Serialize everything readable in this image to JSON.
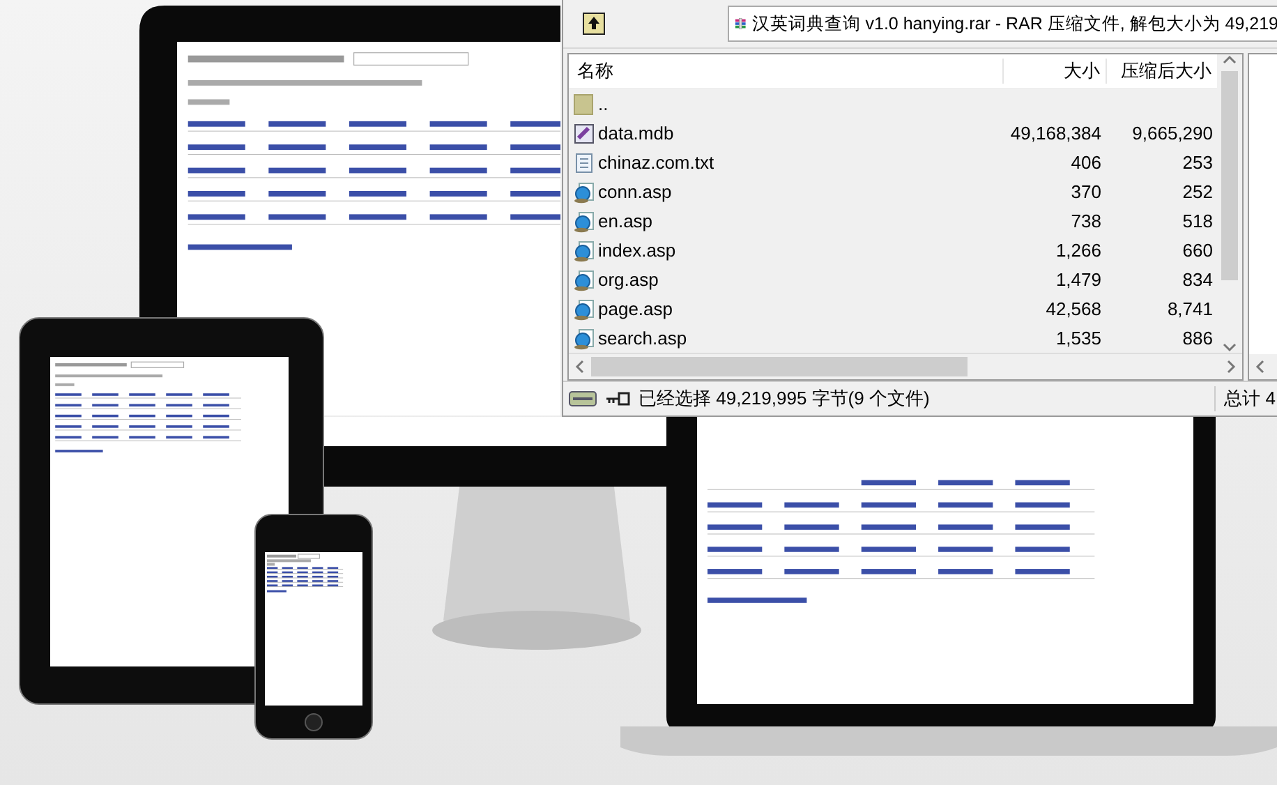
{
  "archive_window": {
    "address": "汉英词典查询 v1.0 hanying.rar - RAR 压缩文件, 解包大小为 49,219",
    "columns": [
      "名称",
      "大小",
      "压缩后大小"
    ],
    "files": [
      {
        "kind": "folder",
        "name": ".."
      },
      {
        "kind": "database",
        "name": "data.mdb",
        "size": "49,168,384",
        "packed": "9,665,290"
      },
      {
        "kind": "text",
        "name": "chinaz.com.txt",
        "size": "406",
        "packed": "253"
      },
      {
        "kind": "web",
        "name": "conn.asp",
        "size": "370",
        "packed": "252"
      },
      {
        "kind": "web",
        "name": "en.asp",
        "size": "738",
        "packed": "518"
      },
      {
        "kind": "web",
        "name": "index.asp",
        "size": "1,266",
        "packed": "660"
      },
      {
        "kind": "web",
        "name": "org.asp",
        "size": "1,479",
        "packed": "834"
      },
      {
        "kind": "web",
        "name": "page.asp",
        "size": "42,568",
        "packed": "8,741"
      },
      {
        "kind": "web",
        "name": "search.asp",
        "size": "1,535",
        "packed": "886"
      }
    ],
    "status": "已经选择 49,219,995 字节(9 个文件)",
    "total": "总计 4"
  }
}
